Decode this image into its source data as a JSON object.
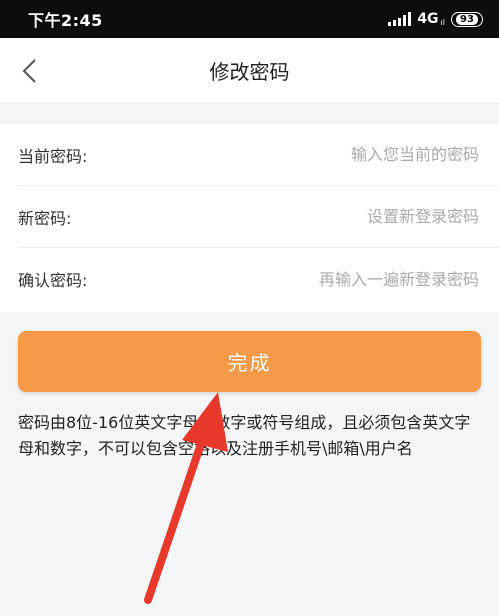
{
  "status_bar": {
    "time": "下午2:45",
    "network": "4G",
    "network_sub": "ıl",
    "battery": "93"
  },
  "nav": {
    "title": "修改密码",
    "back_icon": "chevron-left-icon"
  },
  "form": {
    "current_password": {
      "label": "当前密码:",
      "placeholder": "输入您当前的密码"
    },
    "new_password": {
      "label": "新密码:",
      "placeholder": "设置新登录密码"
    },
    "confirm_password": {
      "label": "确认密码:",
      "placeholder": "再输入一遍新登录密码"
    }
  },
  "submit": {
    "label": "完成"
  },
  "hint": "密码由8位-16位英文字母、数字或符号组成，且必须包含英文字母和数字，不可以包含空格以及注册手机号\\邮箱\\用户名",
  "colors": {
    "accent": "#f69a4a",
    "annotation": "#e8372b"
  }
}
